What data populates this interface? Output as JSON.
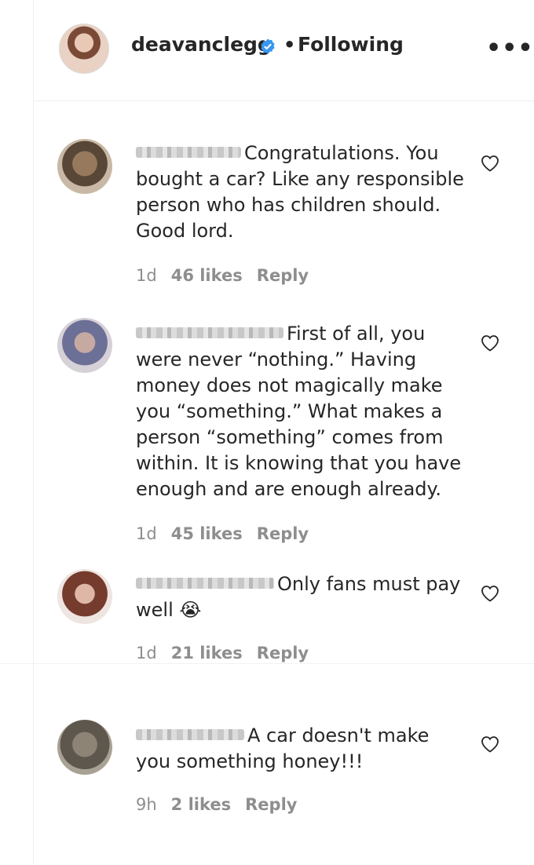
{
  "header": {
    "username": "deavanclegg",
    "separator": "•",
    "follow_status": "Following",
    "more": "•••"
  },
  "comments": [
    {
      "text": "Congratulations. You bought a car? Like any responsible person who has children should. Good lord.",
      "time": "1d",
      "likes": "46 likes",
      "reply": "Reply"
    },
    {
      "text": "First of all, you were never “nothing.” Having money does not magically make you “something.” What makes a person “something” comes from within. It is knowing that you have enough and are enough already.",
      "time": "1d",
      "likes": "45 likes",
      "reply": "Reply"
    },
    {
      "text": "Only fans must pay well",
      "time": "1d",
      "likes": "21 likes",
      "reply": "Reply",
      "emoji": "😭"
    },
    {
      "text": "A car doesn't make you something honey!!!",
      "time": "9h",
      "likes": "2 likes",
      "reply": "Reply"
    }
  ],
  "colors": {
    "verified": "#3897f0",
    "meta": "#8e8e8e",
    "text": "#262626"
  },
  "icons": {
    "verified": "verified-badge-icon",
    "heart": "heart-outline-icon",
    "more": "more-options-icon"
  }
}
